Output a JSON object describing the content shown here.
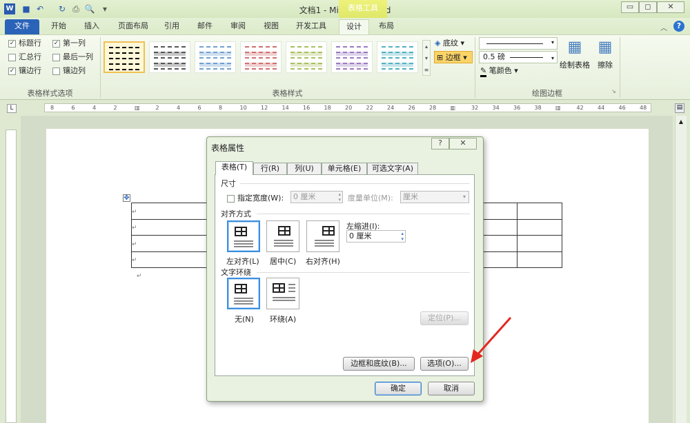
{
  "window": {
    "title": "文档1 - Microsoft Word",
    "context_tab": "表格工具",
    "quick_access": [
      "word-logo-icon",
      "save-icon",
      "undo-icon",
      "redo-icon",
      "print-icon",
      "print-preview-icon",
      "customize-icon"
    ]
  },
  "tabs": [
    {
      "label": "文件"
    },
    {
      "label": "开始"
    },
    {
      "label": "插入"
    },
    {
      "label": "页面布局"
    },
    {
      "label": "引用"
    },
    {
      "label": "邮件"
    },
    {
      "label": "审阅"
    },
    {
      "label": "视图"
    },
    {
      "label": "开发工具"
    },
    {
      "label": "设计",
      "active": true
    },
    {
      "label": "布局"
    }
  ],
  "ribbon": {
    "style_options": {
      "label": "表格样式选项",
      "items": [
        {
          "label": "标题行",
          "checked": true
        },
        {
          "label": "第一列",
          "checked": true
        },
        {
          "label": "汇总行",
          "checked": false
        },
        {
          "label": "最后一列",
          "checked": false
        },
        {
          "label": "镶边行",
          "checked": true
        },
        {
          "label": "镶边列",
          "checked": false
        }
      ]
    },
    "table_styles": {
      "label": "表格样式",
      "colors": [
        "#000000",
        "#555555",
        "#6f9fd0",
        "#d06f6f",
        "#a8c060",
        "#9a7ac0",
        "#50b0c0"
      ],
      "shading": "底纹",
      "borders": "边框"
    },
    "draw_borders": {
      "label": "绘图边框",
      "weight": "0.5 磅",
      "pen_color": "笔颜色",
      "draw_table": "绘制表格",
      "eraser": "擦除"
    }
  },
  "ruler": {
    "marks": [
      "8",
      "6",
      "4",
      "2",
      "",
      "2",
      "4",
      "6",
      "8",
      "10",
      "12",
      "14",
      "16",
      "18",
      "20",
      "22",
      "24",
      "26",
      "28",
      "",
      "32",
      "34",
      "36",
      "38",
      "",
      "42",
      "44",
      "46",
      "48"
    ]
  },
  "dialog": {
    "title": "表格属性",
    "tabs": [
      "表格(T)",
      "行(R)",
      "列(U)",
      "单元格(E)",
      "可选文字(A)"
    ],
    "size": {
      "heading": "尺寸",
      "preferred_width_label": "指定宽度(W):",
      "preferred_width_checked": false,
      "width_value": "0 厘米",
      "unit_label": "度量单位(M):",
      "unit_value": "厘米"
    },
    "alignment": {
      "heading": "对齐方式",
      "options": [
        "左对齐(L)",
        "居中(C)",
        "右对齐(H)"
      ],
      "selected": 0,
      "indent_label": "左缩进(I):",
      "indent_value": "0 厘米"
    },
    "wrapping": {
      "heading": "文字环绕",
      "options": [
        "无(N)",
        "环绕(A)"
      ],
      "selected": 0,
      "position_button": "定位(P)..."
    },
    "borders_button": "边框和底纹(B)...",
    "options_button": "选项(O)...",
    "ok": "确定",
    "cancel": "取消"
  }
}
